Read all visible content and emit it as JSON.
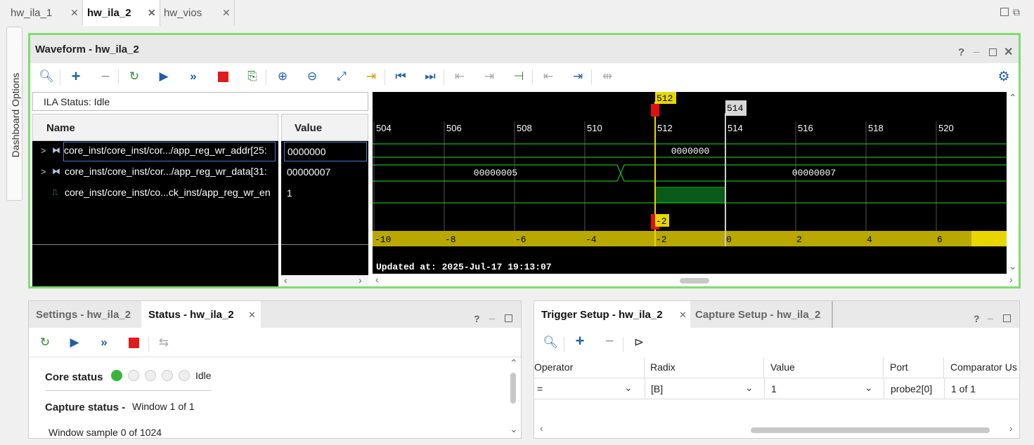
{
  "top_tabs": [
    {
      "label": "hw_ila_1",
      "active": false
    },
    {
      "label": "hw_ila_2",
      "active": true
    },
    {
      "label": "hw_vios",
      "active": false
    }
  ],
  "side_label": "Dashboard Options",
  "waveform": {
    "title": "Waveform - hw_ila_2",
    "ila_status": "ILA Status:  Idle",
    "name_header": "Name",
    "value_header": "Value",
    "signals": [
      {
        "name": "core_inst/core_inst/cor.../app_reg_wr_addr[25:",
        "value": "0000000"
      },
      {
        "name": "core_inst/core_inst/cor.../app_reg_wr_data[31:",
        "value": "00000007"
      },
      {
        "name": "core_inst/core_inst/co...ck_inst/app_reg_wr_en",
        "value": "1"
      }
    ],
    "cursor_label": "512",
    "marker_label": "514",
    "ticks": [
      "504",
      "506",
      "508",
      "510",
      "512",
      "514",
      "516",
      "518",
      "520"
    ],
    "bus_addr_value": "0000000",
    "bus_data_before": "00000005",
    "bus_data_after": "00000007",
    "rel_labels": [
      "-10",
      "-8",
      "-6",
      "-4",
      "-2",
      "0",
      "2",
      "4",
      "6"
    ],
    "rel_cursor_label": "-2",
    "updated": "Updated at: 2025-Jul-17 19:13:07"
  },
  "status_panel": {
    "tabs": [
      "Settings - hw_ila_2",
      "Status - hw_ila_2"
    ],
    "active_tab": 1,
    "core_status_label": "Core status",
    "core_status_value": "Idle",
    "capture_status_label": "Capture status -",
    "capture_status_value": "Window 1 of 1",
    "window_sample": "Window sample 0 of 1024"
  },
  "trigger_panel": {
    "tabs": [
      "Trigger Setup - hw_ila_2",
      "Capture Setup - hw_ila_2"
    ],
    "active_tab": 0,
    "columns": [
      "Operator",
      "Radix",
      "Value",
      "Port",
      "Comparator Us"
    ],
    "row": {
      "operator": "=",
      "radix": "[B]",
      "value": "1",
      "port": "probe2[0]",
      "comparator": "1 of 1"
    }
  },
  "colors": {
    "accent_green": "#7fdd6f",
    "wave_green": "#22dd22",
    "cursor_yellow": "#e8d600",
    "marker_red": "#dd1111",
    "rel_bar": "#b8a800"
  }
}
